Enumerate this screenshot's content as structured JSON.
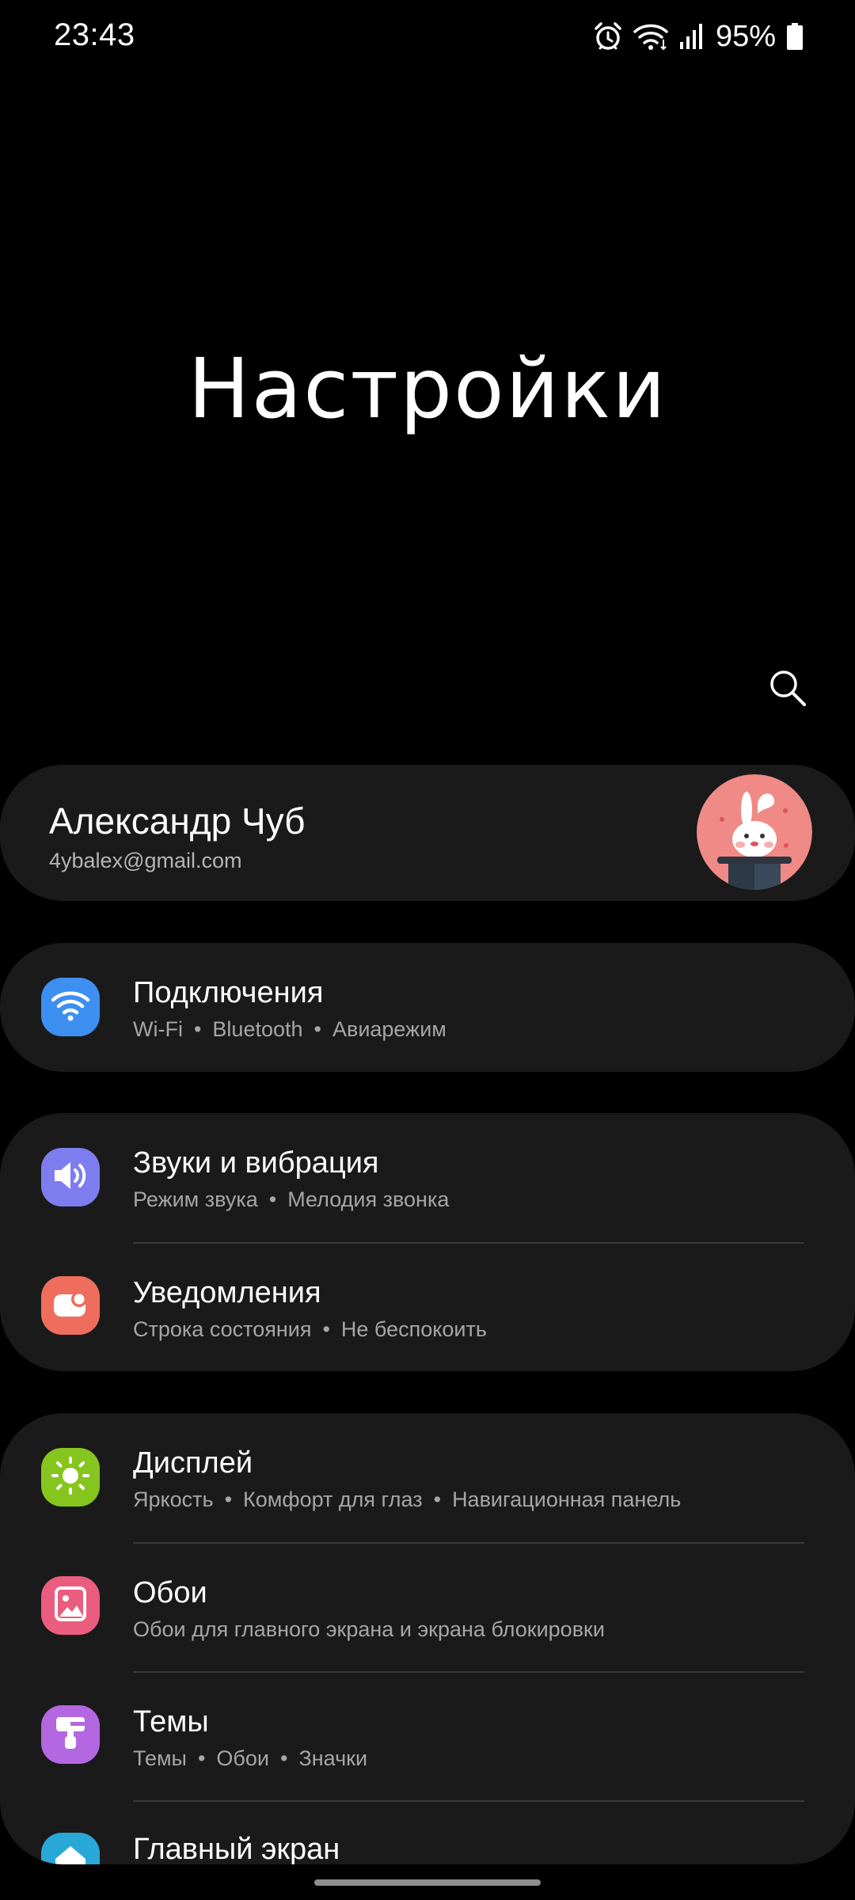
{
  "status_bar": {
    "time": "23:43",
    "battery": "95%",
    "icons": [
      "alarm-icon",
      "wifi-icon",
      "signal-icon",
      "battery-icon"
    ]
  },
  "header": {
    "title": "Настройки",
    "search_icon": "search-icon"
  },
  "profile": {
    "name": "Александр Чуб",
    "email": "4ybalex@gmail.com"
  },
  "settings": [
    {
      "title": "Подключения",
      "subtitle": [
        "Wi-Fi",
        "Bluetooth",
        "Авиарежим"
      ],
      "icon": "wifi-icon",
      "color": "#3d8ff2"
    },
    {
      "title": "Звуки и вибрация",
      "subtitle": [
        "Режим звука",
        "Мелодия звонка"
      ],
      "icon": "volume-icon",
      "color": "#7e7df0"
    },
    {
      "title": "Уведомления",
      "subtitle": [
        "Строка состояния",
        "Не беспокоить"
      ],
      "icon": "notification-icon",
      "color": "#ee6d5c"
    },
    {
      "title": "Дисплей",
      "subtitle": [
        "Яркость",
        "Комфорт для глаз",
        "Навигационная панель"
      ],
      "icon": "brightness-icon",
      "color": "#86c51e"
    },
    {
      "title": "Обои",
      "subtitle": [
        "Обои для главного экрана и экрана блокировки"
      ],
      "icon": "wallpaper-icon",
      "color": "#ea5d7f"
    },
    {
      "title": "Темы",
      "subtitle": [
        "Темы",
        "Обои",
        "Значки"
      ],
      "icon": "themes-icon",
      "color": "#b367e0"
    },
    {
      "title": "Главный экран",
      "subtitle": [],
      "icon": "home-icon",
      "color": "#29a8d8"
    }
  ]
}
